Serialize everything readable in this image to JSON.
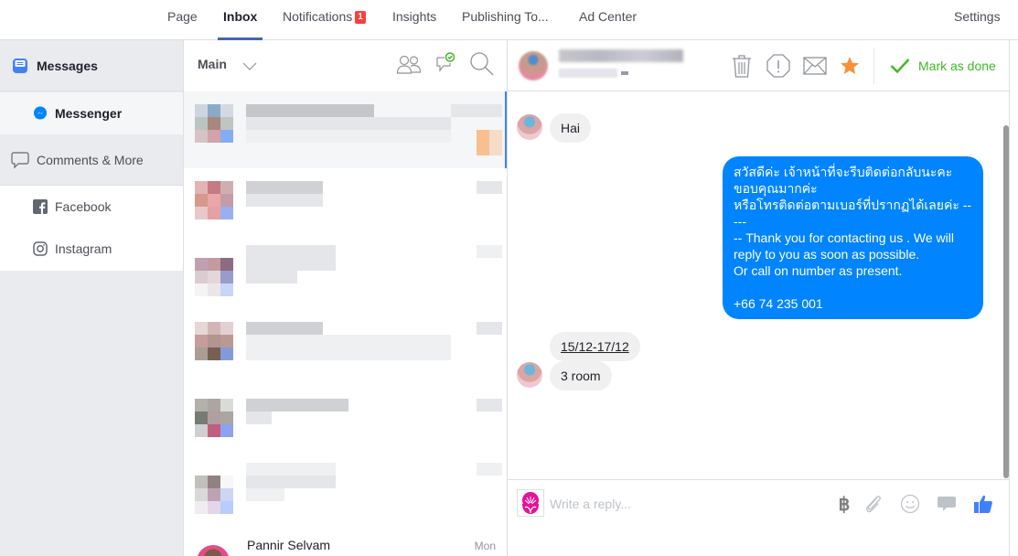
{
  "topnav": {
    "tabs": [
      {
        "label": "Page",
        "active": false
      },
      {
        "label": "Inbox",
        "active": true
      },
      {
        "label": "Notifications",
        "active": false,
        "badge": "1"
      },
      {
        "label": "Insights",
        "active": false
      },
      {
        "label": "Publishing To...",
        "active": false
      },
      {
        "label": "Ad Center",
        "active": false
      }
    ],
    "settings_label": "Settings"
  },
  "sidebar": {
    "messages_label": "Messages",
    "messenger_label": "Messenger",
    "comments_label": "Comments & More",
    "facebook_label": "Facebook",
    "instagram_label": "Instagram"
  },
  "threads": {
    "filter_label": "Main",
    "last_thread": {
      "name": "Pannir Selvam",
      "time": "Mon"
    }
  },
  "conversation": {
    "mark_done_label": "Mark as done",
    "messages": [
      {
        "direction": "in",
        "text": "Hai"
      },
      {
        "direction": "out",
        "text": "สวัสดีค่ะ เจ้าหน้าที่จะรีบติดต่อกลับนะคะ\nขอบคุณมากค่ะ\nหรือโทรติดต่อตามเบอร์ที่ปรากฏได้เลยค่ะ -----\n-- Thank you for contacting us . We will\nreply to you as soon as possible.\nOr call on number as present.\n\n +66 74 235 001"
      },
      {
        "direction": "in",
        "text": "15/12-17/12",
        "underline": true
      },
      {
        "direction": "in",
        "text": "3 room"
      }
    ],
    "reply_placeholder": "Write a reply...",
    "currency_symbol": "฿"
  },
  "colors": {
    "accent_blue": "#4267b2",
    "messenger_blue": "#0084ff",
    "done_green": "#42b72a",
    "star_orange": "#f7923b",
    "badge_red": "#fa3e3e",
    "like_blue": "#4080ff"
  }
}
